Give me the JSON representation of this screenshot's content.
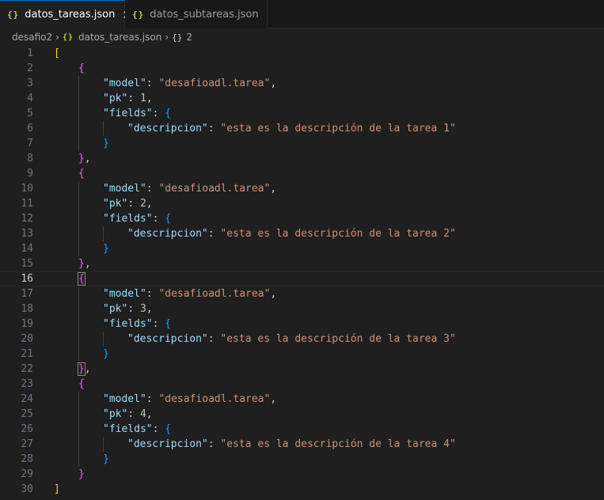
{
  "tabs": [
    {
      "icon": "{}",
      "label": "datos_tareas.json",
      "active": true,
      "close": "✕"
    },
    {
      "icon": "{}",
      "label": "datos_subtareas.json",
      "active": false
    }
  ],
  "breadcrumb": {
    "folder": "desafio2",
    "file_icon": "{}",
    "file": "datos_tareas.json",
    "symbol_icon": "{}",
    "symbol": "2"
  },
  "editor": {
    "current_line": 16,
    "colors": {
      "key": "#9cdcfe",
      "string": "#ce9178",
      "number": "#b5cea8",
      "bracket_level1": "#ffd700",
      "bracket_level2": "#da70d6",
      "bracket_level3": "#179fff"
    },
    "lines": [
      {
        "n": "1",
        "indent": 0,
        "tokens": [
          {
            "t": "[",
            "c": "b1"
          }
        ]
      },
      {
        "n": "2",
        "indent": 1,
        "tokens": [
          {
            "t": "{",
            "c": "b2"
          }
        ]
      },
      {
        "n": "3",
        "indent": 2,
        "tokens": [
          {
            "t": "\"model\"",
            "c": "k"
          },
          {
            "t": ": ",
            "c": "p"
          },
          {
            "t": "\"desafioadl.tarea\"",
            "c": "s"
          },
          {
            "t": ",",
            "c": "p"
          }
        ]
      },
      {
        "n": "4",
        "indent": 2,
        "tokens": [
          {
            "t": "\"pk\"",
            "c": "k"
          },
          {
            "t": ": ",
            "c": "p"
          },
          {
            "t": "1",
            "c": "n"
          },
          {
            "t": ",",
            "c": "p"
          }
        ]
      },
      {
        "n": "5",
        "indent": 2,
        "tokens": [
          {
            "t": "\"fields\"",
            "c": "k"
          },
          {
            "t": ": ",
            "c": "p"
          },
          {
            "t": "{",
            "c": "b3"
          }
        ]
      },
      {
        "n": "6",
        "indent": 3,
        "tokens": [
          {
            "t": "\"descripcion\"",
            "c": "k"
          },
          {
            "t": ": ",
            "c": "p"
          },
          {
            "t": "\"esta es la descripción de la tarea 1\"",
            "c": "s"
          }
        ]
      },
      {
        "n": "7",
        "indent": 2,
        "tokens": [
          {
            "t": "}",
            "c": "b3"
          }
        ]
      },
      {
        "n": "8",
        "indent": 1,
        "tokens": [
          {
            "t": "}",
            "c": "b2"
          },
          {
            "t": ",",
            "c": "p"
          }
        ]
      },
      {
        "n": "9",
        "indent": 1,
        "tokens": [
          {
            "t": "{",
            "c": "b2"
          }
        ]
      },
      {
        "n": "10",
        "indent": 2,
        "tokens": [
          {
            "t": "\"model\"",
            "c": "k"
          },
          {
            "t": ": ",
            "c": "p"
          },
          {
            "t": "\"desafioadl.tarea\"",
            "c": "s"
          },
          {
            "t": ",",
            "c": "p"
          }
        ]
      },
      {
        "n": "11",
        "indent": 2,
        "tokens": [
          {
            "t": "\"pk\"",
            "c": "k"
          },
          {
            "t": ": ",
            "c": "p"
          },
          {
            "t": "2",
            "c": "n"
          },
          {
            "t": ",",
            "c": "p"
          }
        ]
      },
      {
        "n": "12",
        "indent": 2,
        "tokens": [
          {
            "t": "\"fields\"",
            "c": "k"
          },
          {
            "t": ": ",
            "c": "p"
          },
          {
            "t": "{",
            "c": "b3"
          }
        ]
      },
      {
        "n": "13",
        "indent": 3,
        "tokens": [
          {
            "t": "\"descripcion\"",
            "c": "k"
          },
          {
            "t": ": ",
            "c": "p"
          },
          {
            "t": "\"esta es la descripción de la tarea 2\"",
            "c": "s"
          }
        ]
      },
      {
        "n": "14",
        "indent": 2,
        "tokens": [
          {
            "t": "}",
            "c": "b3"
          }
        ]
      },
      {
        "n": "15",
        "indent": 1,
        "tokens": [
          {
            "t": "}",
            "c": "b2"
          },
          {
            "t": ",",
            "c": "p"
          }
        ]
      },
      {
        "n": "16",
        "indent": 1,
        "tokens": [
          {
            "t": "{",
            "c": "b2",
            "match": true
          }
        ]
      },
      {
        "n": "17",
        "indent": 2,
        "tokens": [
          {
            "t": "\"model\"",
            "c": "k"
          },
          {
            "t": ": ",
            "c": "p"
          },
          {
            "t": "\"desafioadl.tarea\"",
            "c": "s"
          },
          {
            "t": ",",
            "c": "p"
          }
        ]
      },
      {
        "n": "18",
        "indent": 2,
        "tokens": [
          {
            "t": "\"pk\"",
            "c": "k"
          },
          {
            "t": ": ",
            "c": "p"
          },
          {
            "t": "3",
            "c": "n"
          },
          {
            "t": ",",
            "c": "p"
          }
        ]
      },
      {
        "n": "19",
        "indent": 2,
        "tokens": [
          {
            "t": "\"fields\"",
            "c": "k"
          },
          {
            "t": ": ",
            "c": "p"
          },
          {
            "t": "{",
            "c": "b3"
          }
        ]
      },
      {
        "n": "20",
        "indent": 3,
        "tokens": [
          {
            "t": "\"descripcion\"",
            "c": "k"
          },
          {
            "t": ": ",
            "c": "p"
          },
          {
            "t": "\"esta es la descripción de la tarea 3\"",
            "c": "s"
          }
        ]
      },
      {
        "n": "21",
        "indent": 2,
        "tokens": [
          {
            "t": "}",
            "c": "b3"
          }
        ]
      },
      {
        "n": "22",
        "indent": 1,
        "tokens": [
          {
            "t": "}",
            "c": "b2",
            "match": true
          },
          {
            "t": ",",
            "c": "p"
          }
        ]
      },
      {
        "n": "23",
        "indent": 1,
        "tokens": [
          {
            "t": "{",
            "c": "b2"
          }
        ]
      },
      {
        "n": "24",
        "indent": 2,
        "tokens": [
          {
            "t": "\"model\"",
            "c": "k"
          },
          {
            "t": ": ",
            "c": "p"
          },
          {
            "t": "\"desafioadl.tarea\"",
            "c": "s"
          },
          {
            "t": ",",
            "c": "p"
          }
        ]
      },
      {
        "n": "25",
        "indent": 2,
        "tokens": [
          {
            "t": "\"pk\"",
            "c": "k"
          },
          {
            "t": ": ",
            "c": "p"
          },
          {
            "t": "4",
            "c": "n"
          },
          {
            "t": ",",
            "c": "p"
          }
        ]
      },
      {
        "n": "26",
        "indent": 2,
        "tokens": [
          {
            "t": "\"fields\"",
            "c": "k"
          },
          {
            "t": ": ",
            "c": "p"
          },
          {
            "t": "{",
            "c": "b3"
          }
        ]
      },
      {
        "n": "27",
        "indent": 3,
        "tokens": [
          {
            "t": "\"descripcion\"",
            "c": "k"
          },
          {
            "t": ": ",
            "c": "p"
          },
          {
            "t": "\"esta es la descripción de la tarea 4\"",
            "c": "s"
          }
        ]
      },
      {
        "n": "28",
        "indent": 2,
        "tokens": [
          {
            "t": "}",
            "c": "b3"
          }
        ]
      },
      {
        "n": "29",
        "indent": 1,
        "tokens": [
          {
            "t": "}",
            "c": "b2"
          }
        ]
      },
      {
        "n": "30",
        "indent": 0,
        "tokens": [
          {
            "t": "]",
            "c": "b1"
          }
        ]
      }
    ]
  }
}
